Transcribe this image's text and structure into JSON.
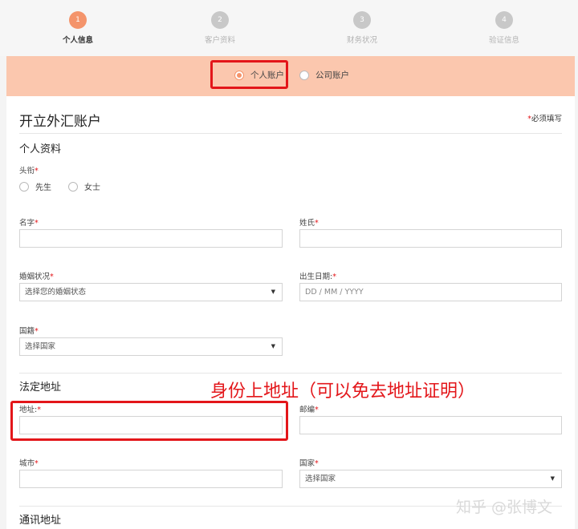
{
  "steps": [
    {
      "num": "1",
      "label": "个人信息"
    },
    {
      "num": "2",
      "label": "客户资料"
    },
    {
      "num": "3",
      "label": "财务状况"
    },
    {
      "num": "4",
      "label": "验证信息"
    }
  ],
  "account_type": {
    "options": [
      "个人账户",
      "公司账户"
    ],
    "selected": "个人账户"
  },
  "form": {
    "title": "开立外汇账户",
    "required_note": "必须填写",
    "personal_section": "个人资料",
    "salutation_label": "头衔",
    "salutation_options": [
      "先生",
      "女士"
    ],
    "first_name_label": "名字",
    "last_name_label": "姓氏",
    "marital_label": "婚姻状况",
    "marital_placeholder": "选择您的婚姻状态",
    "dob_label": "出生日期:",
    "dob_placeholder": "DD / MM / YYYY",
    "nationality_label": "国籍",
    "nationality_placeholder": "选择国家",
    "legal_address_section": "法定地址",
    "address_label": "地址:",
    "postcode_label": "邮编",
    "city_label": "城市",
    "country_label": "国家",
    "country_placeholder": "选择国家",
    "mailing_address_section": "通讯地址",
    "required_mark": "*"
  },
  "annotation": "身份上地址（可以免去地址证明）",
  "watermark": "知乎 @张博文",
  "colors": {
    "accent": "#f4946b",
    "band": "#fbc7ae",
    "highlight": "#e3161a"
  }
}
